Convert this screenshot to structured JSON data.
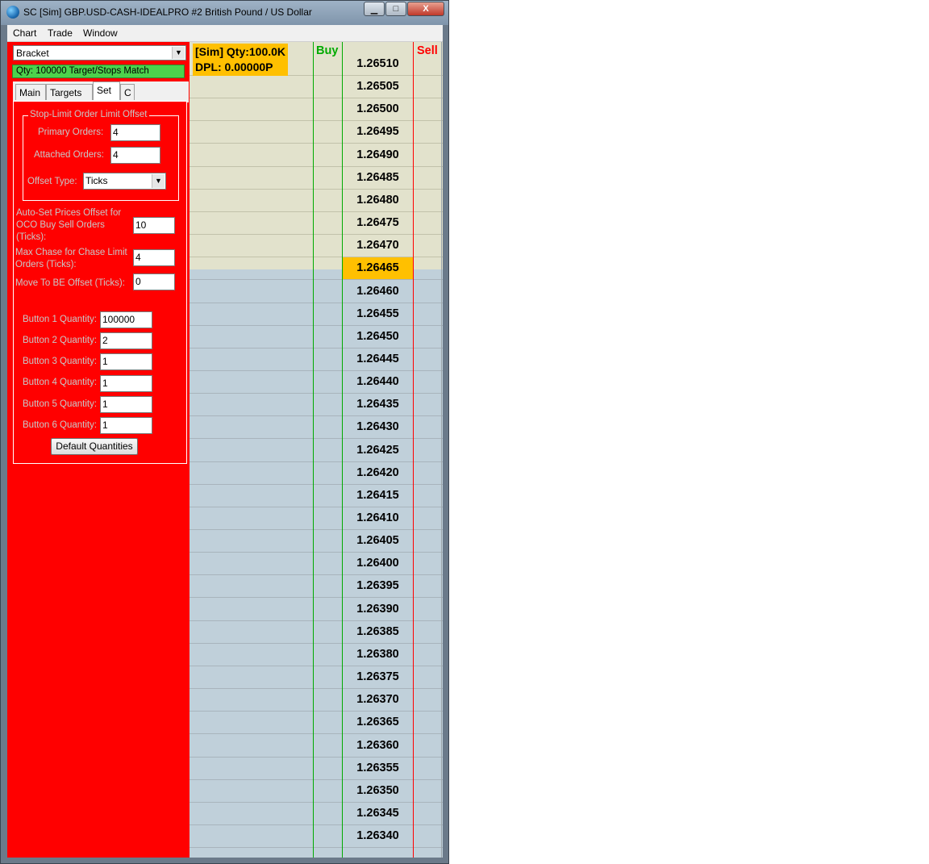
{
  "window": {
    "title": "SC [Sim] GBP.USD-CASH-IDEALPRO  #2  British Pound / US Dollar",
    "controls": {
      "minimize": "▁",
      "maximize": "□",
      "close": "X"
    }
  },
  "menu": [
    "Chart",
    "Trade",
    "Window"
  ],
  "panel": {
    "order_type": "Bracket",
    "match_status": "Qty: 100000 Target/Stops Match",
    "tabs": [
      "Main",
      "Targets",
      "Set",
      "C"
    ],
    "active_tab": "Set",
    "stop_limit_group": {
      "caption": "Stop-Limit Order Limit Offset",
      "primary_label": "Primary Orders:",
      "primary_value": "4",
      "attached_label": "Attached Orders:",
      "attached_value": "4",
      "offset_type_label": "Offset Type:",
      "offset_type_value": "Ticks"
    },
    "auto_set_label": "Auto-Set Prices Offset for OCO Buy Sell Orders (Ticks):",
    "auto_set_value": "10",
    "max_chase_label": "Max Chase for Chase Limit Orders (Ticks):",
    "max_chase_value": "4",
    "move_be_label": "Move To BE Offset (Ticks):",
    "move_be_value": "0",
    "buttons": [
      {
        "label": "Button 1 Quantity:",
        "value": "100000"
      },
      {
        "label": "Button 2 Quantity:",
        "value": "2"
      },
      {
        "label": "Button 3 Quantity:",
        "value": "1"
      },
      {
        "label": "Button 4 Quantity:",
        "value": "1"
      },
      {
        "label": "Button 5 Quantity:",
        "value": "1"
      },
      {
        "label": "Button 6 Quantity:",
        "value": "1"
      }
    ],
    "default_button": "Default Quantities"
  },
  "dom": {
    "sim_line1": "[Sim]  Qty:100.0K",
    "sim_line2": "DPL: 0.00000P",
    "buy_header": "Buy",
    "sell_header": "Sell",
    "buy_color": "#00aa00",
    "sell_color": "#ff0000",
    "highlight_price": "1.26465",
    "prices": [
      "1.26510",
      "1.26505",
      "1.26500",
      "1.26495",
      "1.26490",
      "1.26485",
      "1.26480",
      "1.26475",
      "1.26470",
      "1.26465",
      "1.26460",
      "1.26455",
      "1.26450",
      "1.26445",
      "1.26440",
      "1.26435",
      "1.26430",
      "1.26425",
      "1.26420",
      "1.26415",
      "1.26410",
      "1.26405",
      "1.26400",
      "1.26395",
      "1.26390",
      "1.26385",
      "1.26380",
      "1.26375",
      "1.26370",
      "1.26365",
      "1.26360",
      "1.26355",
      "1.26350",
      "1.26345",
      "1.26340"
    ]
  }
}
